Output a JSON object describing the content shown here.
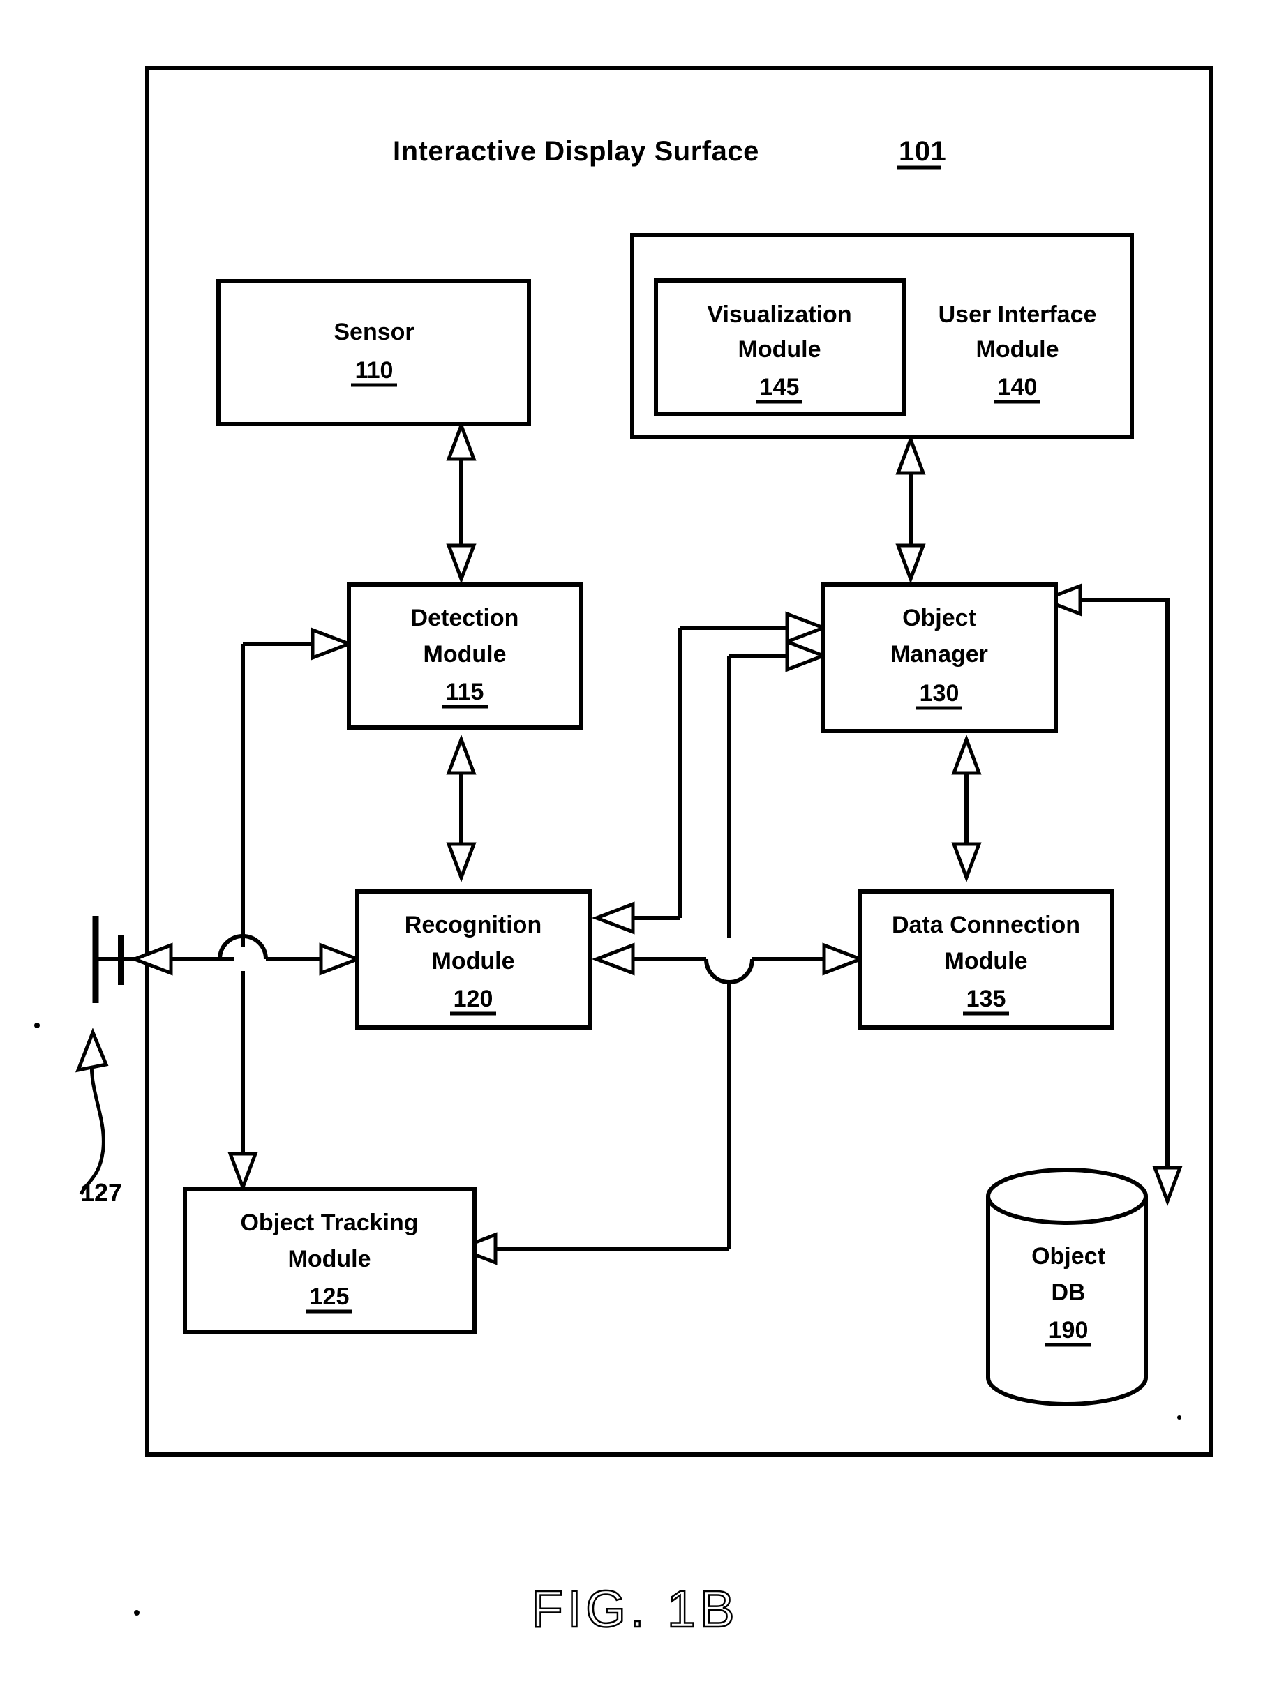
{
  "figure": {
    "caption": "FIG. 1B",
    "outer_title": "Interactive Display Surface",
    "outer_title_ref": "101",
    "left_ref": "127"
  },
  "blocks": [
    {
      "id": "sensor",
      "name": "sensor-block",
      "line1": "Sensor",
      "line2": "",
      "ref": "110"
    },
    {
      "id": "ui-module",
      "name": "user-interface-module-block",
      "line1": "User Interface",
      "line2": "Module",
      "ref": "140"
    },
    {
      "id": "viz-module",
      "name": "visualization-module-block",
      "line1": "Visualization",
      "line2": "Module",
      "ref": "145"
    },
    {
      "id": "detection",
      "name": "detection-module-block",
      "line1": "Detection",
      "line2": "Module",
      "ref": "115"
    },
    {
      "id": "object-manager",
      "name": "object-manager-block",
      "line1": "Object",
      "line2": "Manager",
      "ref": "130"
    },
    {
      "id": "recognition",
      "name": "recognition-module-block",
      "line1": "Recognition",
      "line2": "Module",
      "ref": "120"
    },
    {
      "id": "data-connection",
      "name": "data-connection-module-block",
      "line1": "Data Connection",
      "line2": "Module",
      "ref": "135"
    },
    {
      "id": "object-tracking",
      "name": "object-tracking-module-block",
      "line1": "Object Tracking",
      "line2": "Module",
      "ref": "125"
    },
    {
      "id": "object-db",
      "name": "object-db-cylinder",
      "line1": "Object",
      "line2": "DB",
      "ref": "190"
    }
  ]
}
